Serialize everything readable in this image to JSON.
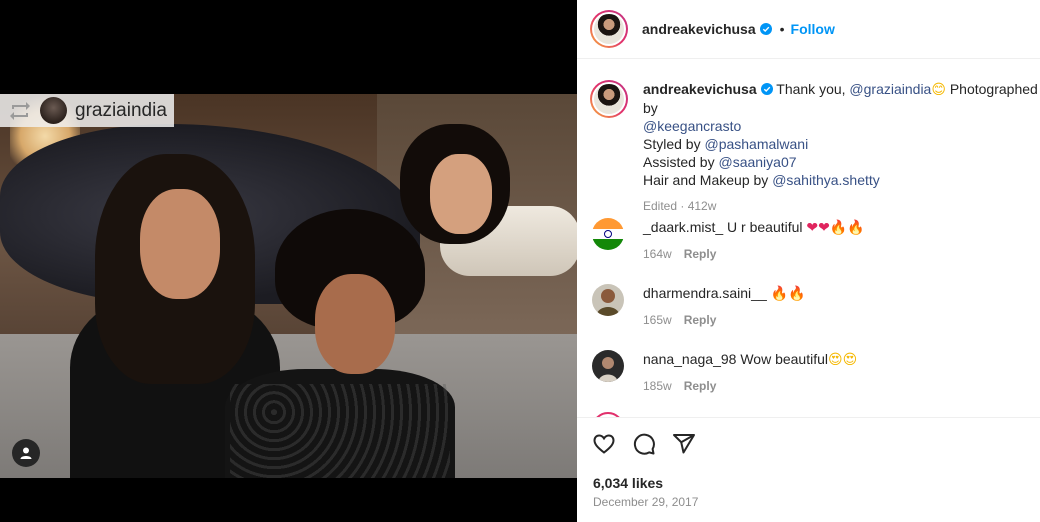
{
  "media": {
    "repost_username": "graziaindia"
  },
  "header": {
    "username": "andreakevichusa",
    "separator": "•",
    "follow_label": "Follow"
  },
  "caption": {
    "username": "andreakevichusa",
    "line1_text": "Thank you, ",
    "line1_mention": "@graziaindia",
    "line1_emoji": "😊",
    "line1_rest": " Photographed by",
    "line2_mention": "@keegancrasto",
    "styled_prefix": "Styled by ",
    "styled_mention": "@pashamalwani",
    "assisted_prefix": "Assisted by ",
    "assisted_mention": "@saaniya07",
    "hair_prefix": "Hair and Makeup by ",
    "hair_mention": "@sahithya.shetty",
    "meta": "Edited · 412w"
  },
  "comments": [
    {
      "username": "_daark.mist_",
      "text": "U r beautiful",
      "hearts": "❤❤",
      "fires": "🔥🔥",
      "time": "164w",
      "reply": "Reply"
    },
    {
      "username": "dharmendra.saini__",
      "text": "",
      "fires": "🔥🔥",
      "time": "165w",
      "reply": "Reply"
    },
    {
      "username": "nana_naga_98",
      "text": "Wow beautiful",
      "faces": "😍😍",
      "time": "185w",
      "reply": "Reply"
    }
  ],
  "stats": {
    "likes": "6,034 likes",
    "date": "December 29, 2017"
  },
  "icons": [
    "repost-icon",
    "user-tag-icon",
    "verified-icon",
    "heart-icon",
    "comment-icon",
    "share-icon"
  ],
  "colors": {
    "link": "#385185",
    "follow": "#0095f6",
    "meta": "#8e8e8e",
    "text": "#262626"
  }
}
